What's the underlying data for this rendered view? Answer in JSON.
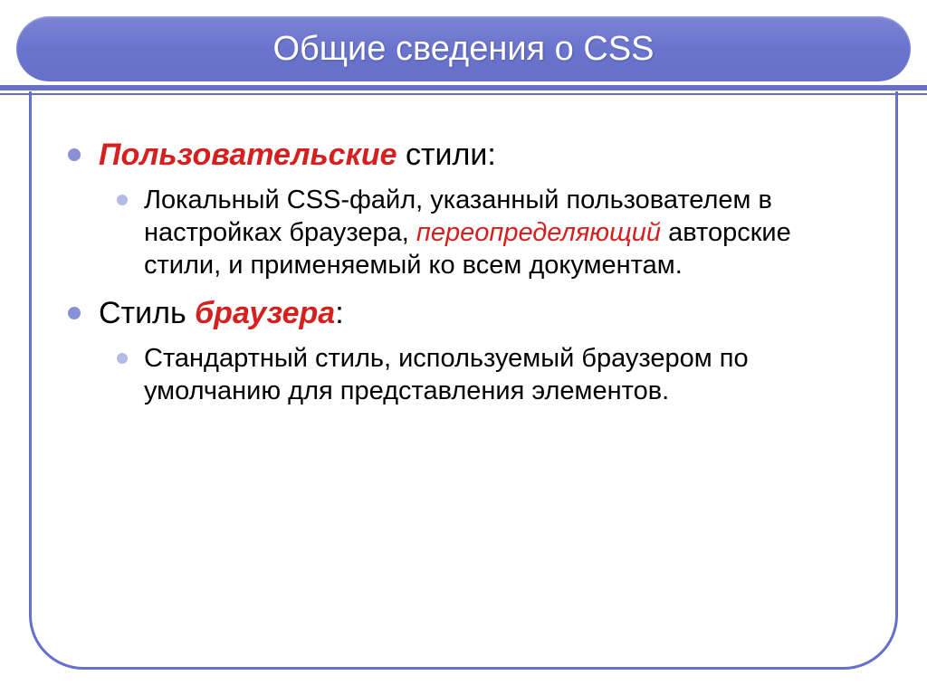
{
  "title": "Общие сведения о CSS",
  "items": [
    {
      "emphasis": "Пользовательские",
      "rest": " стили:",
      "sub": {
        "part1": "Локальный CSS-файл, указанный пользователем в настройках браузера, ",
        "emphasis": "переопределяющий",
        "part2": " авторские стили, и применяемый ко всем документам."
      }
    },
    {
      "prefix": "Стиль ",
      "emphasis": "браузера",
      "rest": ":",
      "sub": {
        "part1": "Стандартный стиль, используемый браузером по умолчанию для представления элементов."
      }
    }
  ]
}
